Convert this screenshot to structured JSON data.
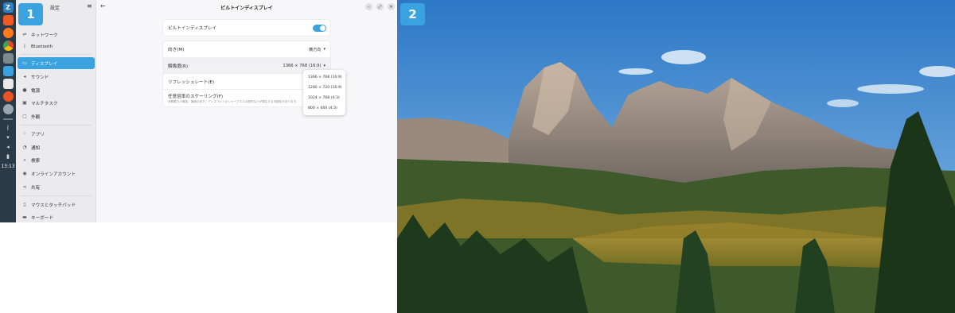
{
  "monitors": [
    {
      "number": "1"
    },
    {
      "number": "2"
    }
  ],
  "dock": {
    "apps": [
      {
        "icon": "zorin-menu-icon",
        "glyph": "Z",
        "color": "#2f7fc1"
      },
      {
        "icon": "brave-icon",
        "glyph": "",
        "color": "#f05a28"
      },
      {
        "icon": "firefox-icon",
        "glyph": "",
        "color": "#ff7b1c"
      },
      {
        "icon": "chrome-icon",
        "glyph": "",
        "color": "#2a9f48"
      },
      {
        "icon": "files-icon",
        "glyph": "",
        "color": "#7a8a8e"
      },
      {
        "icon": "software-icon",
        "glyph": "",
        "color": "#3aa3df"
      },
      {
        "icon": "document-icon",
        "glyph": "",
        "color": "#e8e8e8"
      },
      {
        "icon": "ubuntu-icon",
        "glyph": "",
        "color": "#e95420"
      },
      {
        "icon": "settings-gear-icon",
        "glyph": "",
        "color": "#9aa7b0"
      }
    ],
    "clock": "13:13"
  },
  "sidebar": {
    "title": "設定",
    "menu_glyph": "≡",
    "items": [
      {
        "label": "ネットワーク",
        "icon": "network-icon",
        "glyph": "⇌"
      },
      {
        "label": "Bluetooth",
        "icon": "bluetooth-icon",
        "glyph": "ᛒ"
      },
      {
        "label": "ディスプレイ",
        "icon": "display-icon",
        "glyph": "▭"
      },
      {
        "label": "サウンド",
        "icon": "sound-icon",
        "glyph": "◂"
      },
      {
        "label": "電源",
        "icon": "power-icon",
        "glyph": "●"
      },
      {
        "label": "マルチタスク",
        "icon": "multitasking-icon",
        "glyph": "▣"
      },
      {
        "label": "外観",
        "icon": "appearance-icon",
        "glyph": "▢"
      },
      {
        "label": "アプリ",
        "icon": "apps-icon",
        "glyph": "⁘"
      },
      {
        "label": "通知",
        "icon": "notifications-icon",
        "glyph": "◔"
      },
      {
        "label": "検索",
        "icon": "search-icon",
        "glyph": "⌕"
      },
      {
        "label": "オンラインアカウント",
        "icon": "online-accounts-icon",
        "glyph": "◉"
      },
      {
        "label": "共有",
        "icon": "sharing-icon",
        "glyph": "⋖"
      },
      {
        "label": "マウスとタッチパッド",
        "icon": "mouse-icon",
        "glyph": "▯"
      },
      {
        "label": "キーボード",
        "icon": "keyboard-icon",
        "glyph": "▬"
      }
    ]
  },
  "window": {
    "title": "ビルトインディスプレイ",
    "back_glyph": "←",
    "minimize_glyph": "–",
    "maximize_glyph": "⤢",
    "close_glyph": "✕"
  },
  "display": {
    "builtin_label": "ビルトインディスプレイ",
    "builtin_enabled": true,
    "orientation_label": "向き(M)",
    "orientation_value": "横方向",
    "resolution_label": "解像度(R)",
    "resolution_value": "1366 × 768 (16:9)",
    "refresh_label": "リフレッシュレート(E)",
    "scaling_label": "任意倍率のスケーリング(F)",
    "scaling_desc": "消費電力の増加、速度の低下、ディスプレイのシャープネスの損失などが発生する可能性があります。",
    "caret": "▾",
    "resolution_options": [
      "1366 × 768 (16:9)",
      "1280 × 720 (16:9)",
      "1024 × 768 (4:3)",
      "800 × 600 (4:3)"
    ]
  }
}
